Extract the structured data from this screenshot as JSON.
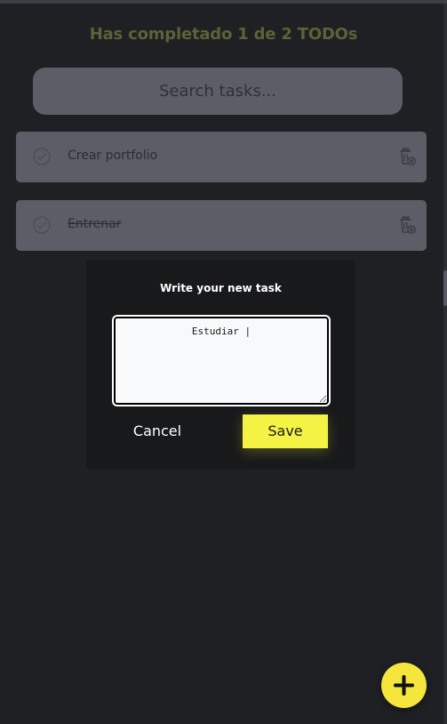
{
  "header": {
    "title": "Has completado 1 de 2 TODOs"
  },
  "search": {
    "placeholder": "Search tasks..."
  },
  "tasks": [
    {
      "label": "Crear portfolio",
      "completed": false
    },
    {
      "label": "Entrenar",
      "completed": true
    }
  ],
  "modal": {
    "title": "Write your new task",
    "textarea_value": "Estudiar |",
    "cancel_label": "Cancel",
    "save_label": "Save"
  },
  "colors": {
    "background": "#1e2024",
    "accent": "#f4f244",
    "card": "#5b5e66",
    "modal": "#18191b"
  },
  "icons": {
    "task_check": "check-circle-icon",
    "task_delete": "trash-icon",
    "fab": "plus-icon"
  }
}
